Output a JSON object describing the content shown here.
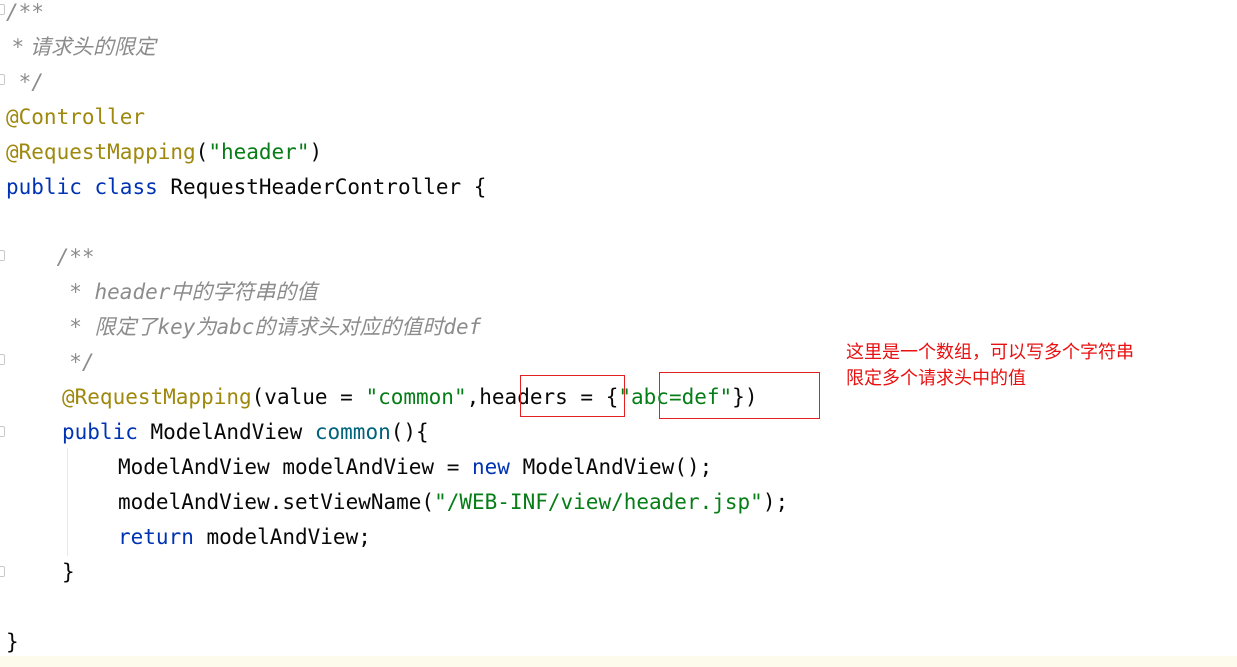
{
  "colors": {
    "background": "#ffffff",
    "comment": "#8c8c8c",
    "annotation": "#9e880d",
    "keyword": "#0033b3",
    "string": "#067d17",
    "method": "#00627a",
    "highlight_box": "#e32121",
    "note_text": "#e81010"
  },
  "code": {
    "l1": "/**",
    "l2": " * 请求头的限定",
    "l3": " */",
    "l4": "@Controller",
    "l5_ann": "@RequestMapping",
    "l5_open": "(",
    "l5_str": "\"header\"",
    "l5_close": ")",
    "l6_kw1": "public",
    "l6_kw2": "class",
    "l6_rest": " RequestHeaderController {",
    "l8": "    /**",
    "l9_a": "     * ",
    "l9_b": "header",
    "l9_c": "中的字符串的值",
    "l10_a": "     * ",
    "l10_b": "限定了",
    "l10_c": "key",
    "l10_d": "为",
    "l10_e": "abc",
    "l10_f": "的请求头对应的值时",
    "l10_g": "def",
    "l11": "     */",
    "l12_ann": "@RequestMapping",
    "l12_a": "(value = ",
    "l12_str1": "\"common\"",
    "l12_b": ",",
    "l12_c": "headers",
    "l12_d": " = ",
    "l12_e": "{",
    "l12_str2": "\"abc=def\"",
    "l12_f": "}",
    "l12_g": ")",
    "l13_kw": "public",
    "l13_a": " ModelAndView ",
    "l13_fn": "common",
    "l13_b": "(){",
    "l14_a": "ModelAndView modelAndView = ",
    "l14_kw": "new",
    "l14_b": " ModelAndView();",
    "l15_a": "modelAndView.setViewName(",
    "l15_str": "\"/WEB-INF/view/header.jsp\"",
    "l15_b": ");",
    "l16_kw": "return",
    "l16_a": " modelAndView;",
    "l17": "}",
    "l19": "}"
  },
  "note": {
    "line1": "这里是一个数组，可以写多个字符串",
    "line2": "限定多个请求头中的值"
  }
}
